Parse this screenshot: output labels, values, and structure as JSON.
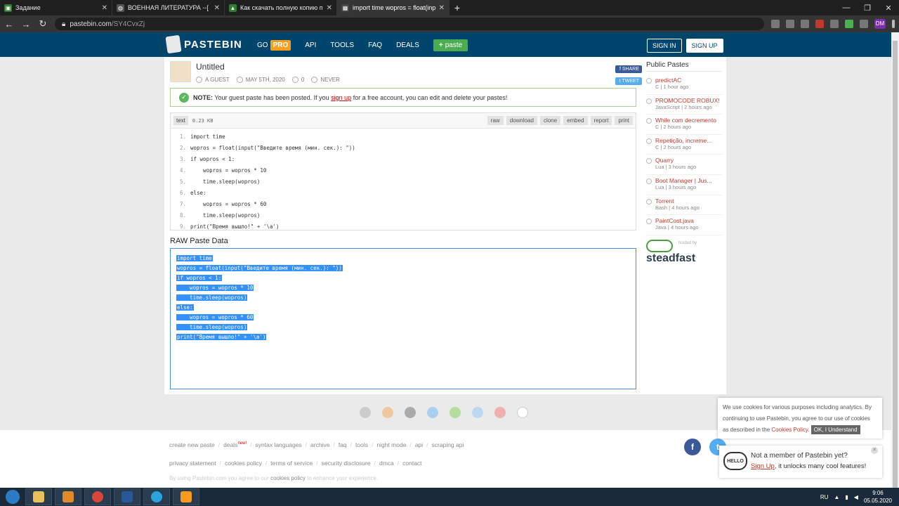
{
  "browser": {
    "tabs": [
      {
        "title": "Задание",
        "active": false,
        "color": "#2e7d32"
      },
      {
        "title": "ВОЕННАЯ ЛИТЕРАТУРА --[ Военная",
        "active": false,
        "color": "#555555"
      },
      {
        "title": "Как скачать полную копию пр...",
        "active": false,
        "color": "#2e7d32"
      },
      {
        "title": "import time wopros = float(input(",
        "active": true,
        "color": "#444444"
      }
    ],
    "url_host": "pastebin.com",
    "url_path": "/SY4CvxZj"
  },
  "header": {
    "logo": "PASTEBIN",
    "go": "GO",
    "pro": "PRO",
    "api": "API",
    "tools": "TOOLS",
    "faq": "FAQ",
    "deals": "DEALS",
    "paste": "paste",
    "sign_in": "SIGN IN",
    "sign_up": "SIGN UP"
  },
  "paste": {
    "title": "Untitled",
    "author": "A GUEST",
    "date": "MAY 5TH, 2020",
    "views": "0",
    "expires": "NEVER",
    "share": "SHARE",
    "tweet": "TWEET"
  },
  "notice": {
    "label": "NOTE:",
    "text1": "Your guest paste has been posted. If you",
    "link": "sign up",
    "text2": "for a free account, you can edit and delete your pastes!"
  },
  "codebar": {
    "lang": "text",
    "size": "0.23 KB",
    "actions": [
      "raw",
      "download",
      "clone",
      "embed",
      "report",
      "print"
    ]
  },
  "code_lines": [
    "import time",
    "wopros = float(input(\"Введите время (мин. сек.): \"))",
    "if wopros < 1:",
    "    wopros = wopros * 10",
    "    time.sleep(wopros)",
    "else:",
    "    wopros = wopros * 60",
    "    time.sleep(wopros)",
    "print(\"Время вышло!\" + '\\a')"
  ],
  "raw": {
    "title": "RAW Paste Data"
  },
  "sidebar": {
    "title": "Public Pastes",
    "items": [
      {
        "name": "predictAC",
        "meta": "C | 1 hour ago"
      },
      {
        "name": "PROMOCODE ROBUX!",
        "meta": "JavaScript | 2 hours ago"
      },
      {
        "name": "While com decremento",
        "meta": "C | 2 hours ago"
      },
      {
        "name": "Repetição, increme...",
        "meta": "C | 2 hours ago"
      },
      {
        "name": "Quarry",
        "meta": "Lua | 3 hours ago"
      },
      {
        "name": "Boot Manager | Jus...",
        "meta": "Lua | 3 hours ago"
      },
      {
        "name": "Torrent",
        "meta": "Bash | 4 hours ago"
      },
      {
        "name": "PaintCost.java",
        "meta": "Java | 4 hours ago"
      }
    ],
    "hosted_by": "hosted by",
    "sponsor": "steadfast"
  },
  "footer": {
    "links_row1": [
      "create new paste",
      "deals",
      "syntax languages",
      "archive",
      "faq",
      "tools",
      "night mode",
      "api",
      "scraping api"
    ],
    "new_badge": "new!",
    "links_row2": [
      "privacy statement",
      "cookies policy",
      "terms of service",
      "security disclosure",
      "dmca",
      "contact"
    ],
    "note_prefix": "By using Pastebin.com you agree to our",
    "note_link": "cookies policy",
    "note_suffix": "to enhance your experience."
  },
  "cookie": {
    "text": "We use cookies for various purposes including analytics. By continuing to use Pastebin, you agree to our use of cookies as described in the",
    "link": "Cookies Policy.",
    "button": "OK, I Understand"
  },
  "member": {
    "hello": "HELLO",
    "line1": "Not a member of Pastebin yet?",
    "link": "Sign Up",
    "line2": ", it unlocks many cool features!"
  },
  "taskbar": {
    "lang": "RU",
    "time": "9:06",
    "date": "05.05.2020"
  }
}
